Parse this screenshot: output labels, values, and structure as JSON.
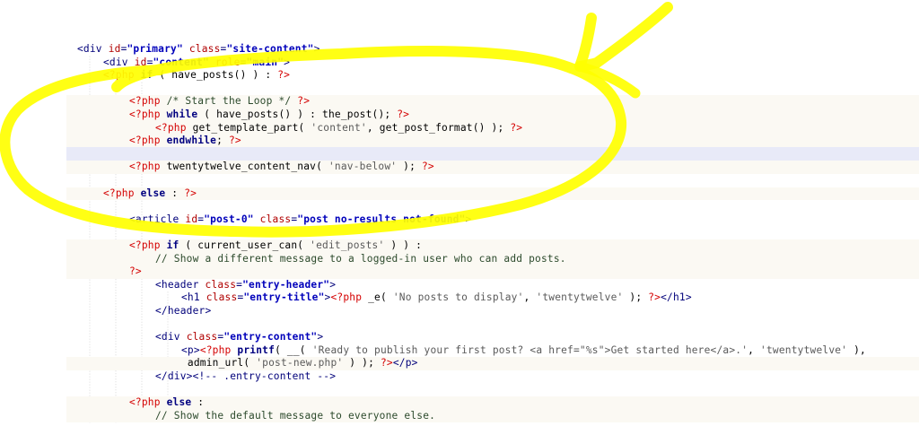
{
  "colors": {
    "tag": "#00007a",
    "attribute": "#b00000",
    "attribute_value": "#0000bb",
    "php_delimiter": "#d40000",
    "keyword": "#000080",
    "string": "#5a5a5a",
    "comment": "#2c4a2c",
    "highlight_annotation": "#ffff00",
    "current_line_bg": "#e8eaf8",
    "php_block_bg": "#fbf9f3"
  },
  "editor": {
    "current_line_index": 8,
    "lines": [
      {
        "indent": 0,
        "bg": "none",
        "tokens": [
          [
            "tag",
            "<div "
          ],
          [
            "attr",
            "id"
          ],
          [
            "tag",
            "="
          ],
          [
            "str",
            "\"primary\""
          ],
          [
            "tag",
            " "
          ],
          [
            "attr",
            "class"
          ],
          [
            "tag",
            "="
          ],
          [
            "str",
            "\"site-content\""
          ],
          [
            "tag",
            ">"
          ]
        ]
      },
      {
        "indent": 1,
        "bg": "none",
        "tokens": [
          [
            "tag",
            "<div "
          ],
          [
            "attr",
            "id"
          ],
          [
            "tag",
            "="
          ],
          [
            "str",
            "\"content\""
          ],
          [
            "tag",
            " "
          ],
          [
            "attr",
            "role"
          ],
          [
            "tag",
            "="
          ],
          [
            "str",
            "\"main\""
          ],
          [
            "tag",
            ">"
          ]
        ]
      },
      {
        "indent": 1,
        "bg": "none",
        "tokens": [
          [
            "php",
            "<?php"
          ],
          [
            "kw",
            " if"
          ],
          [
            "txt",
            " ( have_posts() ) : "
          ],
          [
            "php",
            "?>"
          ]
        ]
      },
      {
        "indent": 0,
        "bg": "none",
        "tokens": []
      },
      {
        "indent": 2,
        "bg": "php",
        "tokens": [
          [
            "php",
            "<?php"
          ],
          [
            "cm",
            " /* Start the Loop */ "
          ],
          [
            "php",
            "?>"
          ]
        ]
      },
      {
        "indent": 2,
        "bg": "php",
        "tokens": [
          [
            "php",
            "<?php"
          ],
          [
            "kw",
            " while"
          ],
          [
            "txt",
            " ( have_posts() ) : the_post(); "
          ],
          [
            "php",
            "?>"
          ]
        ]
      },
      {
        "indent": 3,
        "bg": "php",
        "tokens": [
          [
            "php",
            "<?php"
          ],
          [
            "txt",
            " get_template_part( "
          ],
          [
            "sq",
            "'content'"
          ],
          [
            "txt",
            ", get_post_format() ); "
          ],
          [
            "php",
            "?>"
          ]
        ]
      },
      {
        "indent": 2,
        "bg": "php",
        "tokens": [
          [
            "php",
            "<?php"
          ],
          [
            "kw",
            " endwhile"
          ],
          [
            "txt",
            "; "
          ],
          [
            "php",
            "?>"
          ]
        ]
      },
      {
        "indent": 0,
        "bg": "none",
        "tokens": []
      },
      {
        "indent": 2,
        "bg": "php",
        "tokens": [
          [
            "php",
            "<?php"
          ],
          [
            "txt",
            " twentytwelve_content_nav( "
          ],
          [
            "sq",
            "'nav-below'"
          ],
          [
            "txt",
            " ); "
          ],
          [
            "php",
            "?>"
          ]
        ]
      },
      {
        "indent": 0,
        "bg": "none",
        "tokens": []
      },
      {
        "indent": 1,
        "bg": "php",
        "tokens": [
          [
            "php",
            "<?php"
          ],
          [
            "kw",
            " else"
          ],
          [
            "txt",
            " : "
          ],
          [
            "php",
            "?>"
          ]
        ]
      },
      {
        "indent": 0,
        "bg": "none",
        "tokens": []
      },
      {
        "indent": 2,
        "bg": "none",
        "tokens": [
          [
            "tag",
            "<article "
          ],
          [
            "attr",
            "id"
          ],
          [
            "tag",
            "="
          ],
          [
            "str",
            "\"post-0\""
          ],
          [
            "tag",
            " "
          ],
          [
            "attr",
            "class"
          ],
          [
            "tag",
            "="
          ],
          [
            "str",
            "\"post no-results not-found\""
          ],
          [
            "tag",
            ">"
          ]
        ]
      },
      {
        "indent": 0,
        "bg": "none",
        "tokens": []
      },
      {
        "indent": 2,
        "bg": "php",
        "tokens": [
          [
            "php",
            "<?php"
          ],
          [
            "kw",
            " if"
          ],
          [
            "txt",
            " ( current_user_can( "
          ],
          [
            "sq",
            "'edit_posts'"
          ],
          [
            "txt",
            " ) ) :"
          ]
        ]
      },
      {
        "indent": 3,
        "bg": "php",
        "tokens": [
          [
            "cm",
            "// Show a different message to a logged-in user who can add posts."
          ]
        ]
      },
      {
        "indent": 2,
        "bg": "php",
        "tokens": [
          [
            "php",
            "?>"
          ]
        ]
      },
      {
        "indent": 3,
        "bg": "none",
        "tokens": [
          [
            "tag",
            "<header "
          ],
          [
            "attr",
            "class"
          ],
          [
            "tag",
            "="
          ],
          [
            "str",
            "\"entry-header\""
          ],
          [
            "tag",
            ">"
          ]
        ]
      },
      {
        "indent": 4,
        "bg": "none",
        "tokens": [
          [
            "tag",
            "<h1 "
          ],
          [
            "attr",
            "class"
          ],
          [
            "tag",
            "="
          ],
          [
            "str",
            "\"entry-title\""
          ],
          [
            "tag",
            ">"
          ],
          [
            "php",
            "<?php"
          ],
          [
            "txt",
            " _e( "
          ],
          [
            "sq",
            "'No posts to display'"
          ],
          [
            "txt",
            ", "
          ],
          [
            "sq",
            "'twentytwelve'"
          ],
          [
            "txt",
            " ); "
          ],
          [
            "php",
            "?>"
          ],
          [
            "tag",
            "</h1>"
          ]
        ]
      },
      {
        "indent": 3,
        "bg": "none",
        "tokens": [
          [
            "tag",
            "</header>"
          ]
        ]
      },
      {
        "indent": 0,
        "bg": "none",
        "tokens": []
      },
      {
        "indent": 3,
        "bg": "none",
        "tokens": [
          [
            "tag",
            "<div "
          ],
          [
            "attr",
            "class"
          ],
          [
            "tag",
            "="
          ],
          [
            "str",
            "\"entry-content\""
          ],
          [
            "tag",
            ">"
          ]
        ]
      },
      {
        "indent": 4,
        "bg": "none",
        "tokens": [
          [
            "tag",
            "<p>"
          ],
          [
            "php",
            "<?php"
          ],
          [
            "kw",
            " printf"
          ],
          [
            "txt",
            "( __( "
          ],
          [
            "sq",
            "'Ready to publish your first post? <a href=\"%s\">Get started here</a>.'"
          ],
          [
            "txt",
            ", "
          ],
          [
            "sq",
            "'twentytwelve'"
          ],
          [
            "txt",
            " ),"
          ]
        ]
      },
      {
        "indent": 4,
        "bg": "php",
        "tokens": [
          [
            "txt",
            " admin_url( "
          ],
          [
            "sq",
            "'post-new.php'"
          ],
          [
            "txt",
            " ) ); "
          ],
          [
            "php",
            "?>"
          ],
          [
            "tag",
            "</p>"
          ]
        ]
      },
      {
        "indent": 3,
        "bg": "none",
        "tokens": [
          [
            "tag",
            "</div>"
          ],
          [
            "tag",
            "<!-- .entry-content -->"
          ]
        ]
      },
      {
        "indent": 0,
        "bg": "none",
        "tokens": []
      },
      {
        "indent": 2,
        "bg": "php",
        "tokens": [
          [
            "php",
            "<?php"
          ],
          [
            "kw",
            " else"
          ],
          [
            "txt",
            " :"
          ]
        ]
      },
      {
        "indent": 3,
        "bg": "php",
        "tokens": [
          [
            "cm",
            "// Show the default message to everyone else."
          ]
        ]
      }
    ]
  }
}
